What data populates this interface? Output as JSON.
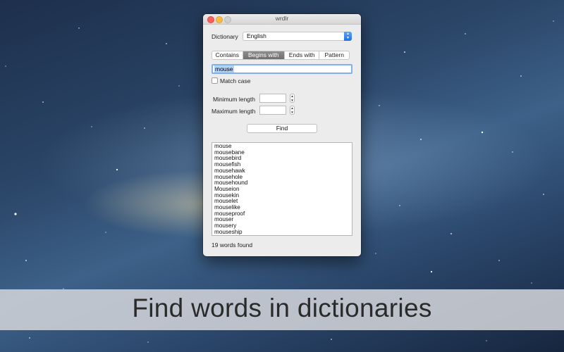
{
  "window": {
    "title": "wrdlr"
  },
  "dictionary": {
    "label": "Dictionary",
    "selected": "English"
  },
  "modes": [
    {
      "label": "Contains",
      "active": false
    },
    {
      "label": "Begins with",
      "active": true
    },
    {
      "label": "Ends with",
      "active": false
    },
    {
      "label": "Pattern",
      "active": false
    }
  ],
  "search": {
    "value": "mouse"
  },
  "options": {
    "match_case_label": "Match case",
    "match_case_checked": false,
    "min_length_label": "Minimum length",
    "max_length_label": "Maximum length",
    "min_length_value": "",
    "max_length_value": ""
  },
  "find_button": {
    "label": "Find"
  },
  "results": {
    "items": [
      "mouse",
      "mousebane",
      "mousebird",
      "mousefish",
      "mousehawk",
      "mousehole",
      "mousehound",
      "Mouseion",
      "mousekin",
      "mouselet",
      "mouselike",
      "mouseproof",
      "mouser",
      "mousery",
      "mouseship"
    ]
  },
  "status": {
    "text": "19 words found"
  },
  "banner": {
    "tagline": "Find words in dictionaries"
  },
  "colors": {
    "accent": "#1e71e6",
    "active_segment": "#7a7a7a",
    "selection": "#b3d3fb"
  }
}
